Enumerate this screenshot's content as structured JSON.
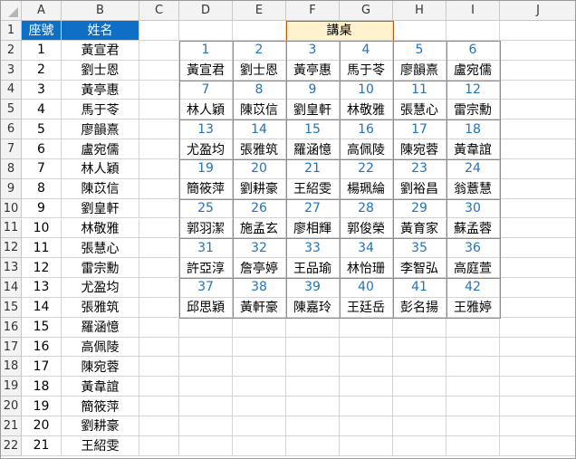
{
  "columns": [
    "A",
    "B",
    "C",
    "D",
    "E",
    "F",
    "G",
    "H",
    "I",
    "J"
  ],
  "rows": [
    1,
    2,
    3,
    4,
    5,
    6,
    7,
    8,
    9,
    10,
    11,
    12,
    13,
    14,
    15,
    16,
    17,
    18,
    19,
    20,
    21,
    22
  ],
  "roster": {
    "header": {
      "seat": "座號",
      "name": "姓名"
    },
    "students": [
      {
        "seat": "1",
        "name": "黃宣君"
      },
      {
        "seat": "2",
        "name": "劉士恩"
      },
      {
        "seat": "3",
        "name": "黃亭惠"
      },
      {
        "seat": "4",
        "name": "馬于苓"
      },
      {
        "seat": "5",
        "name": "廖韻熹"
      },
      {
        "seat": "6",
        "name": "盧宛儒"
      },
      {
        "seat": "7",
        "name": "林人穎"
      },
      {
        "seat": "8",
        "name": "陳苡信"
      },
      {
        "seat": "9",
        "name": "劉皇軒"
      },
      {
        "seat": "10",
        "name": "林敬雅"
      },
      {
        "seat": "11",
        "name": "張慧心"
      },
      {
        "seat": "12",
        "name": "雷宗勳"
      },
      {
        "seat": "13",
        "name": "尤盈均"
      },
      {
        "seat": "14",
        "name": "張雅筑"
      },
      {
        "seat": "15",
        "name": "羅涵憶"
      },
      {
        "seat": "16",
        "name": "高佩陵"
      },
      {
        "seat": "17",
        "name": "陳宛蓉"
      },
      {
        "seat": "18",
        "name": "黃韋誼"
      },
      {
        "seat": "19",
        "name": "簡筱萍"
      },
      {
        "seat": "20",
        "name": "劉耕豪"
      },
      {
        "seat": "21",
        "name": "王紹雯"
      }
    ]
  },
  "podium_label": "講桌",
  "seating": [
    {
      "numbers": [
        "1",
        "2",
        "3",
        "4",
        "5",
        "6"
      ],
      "names": [
        "黃宣君",
        "劉士恩",
        "黃亭惠",
        "馬于苓",
        "廖韻熹",
        "盧宛儒"
      ]
    },
    {
      "numbers": [
        "7",
        "8",
        "9",
        "10",
        "11",
        "12"
      ],
      "names": [
        "林人穎",
        "陳苡信",
        "劉皇軒",
        "林敬雅",
        "張慧心",
        "雷宗勳"
      ]
    },
    {
      "numbers": [
        "13",
        "14",
        "15",
        "16",
        "17",
        "18"
      ],
      "names": [
        "尤盈均",
        "張雅筑",
        "羅涵憶",
        "高佩陵",
        "陳宛蓉",
        "黃韋誼"
      ]
    },
    {
      "numbers": [
        "19",
        "20",
        "21",
        "22",
        "23",
        "24"
      ],
      "names": [
        "簡筱萍",
        "劉耕豪",
        "王紹雯",
        "楊珮綸",
        "劉裕昌",
        "翁薏慧"
      ]
    },
    {
      "numbers": [
        "25",
        "26",
        "27",
        "28",
        "29",
        "30"
      ],
      "names": [
        "郭羽潔",
        "施孟玄",
        "廖相輝",
        "郭俊榮",
        "黃育家",
        "蘇孟蓉"
      ]
    },
    {
      "numbers": [
        "31",
        "32",
        "33",
        "34",
        "35",
        "36"
      ],
      "names": [
        "許亞淳",
        "詹亭婷",
        "王品瑜",
        "林怡珊",
        "李智弘",
        "高庭萱"
      ]
    },
    {
      "numbers": [
        "37",
        "38",
        "39",
        "40",
        "41",
        "42"
      ],
      "names": [
        "邱思穎",
        "黃軒豪",
        "陳嘉玲",
        "王廷岳",
        "彭名揚",
        "王雅婷"
      ]
    }
  ],
  "colors": {
    "roster_header_bg": "#0f6fc6",
    "roster_header_text": "#ffffff",
    "seat_number_text": "#1f73c3",
    "podium_bg": "#fff2cc",
    "podium_border": "#c65911"
  }
}
